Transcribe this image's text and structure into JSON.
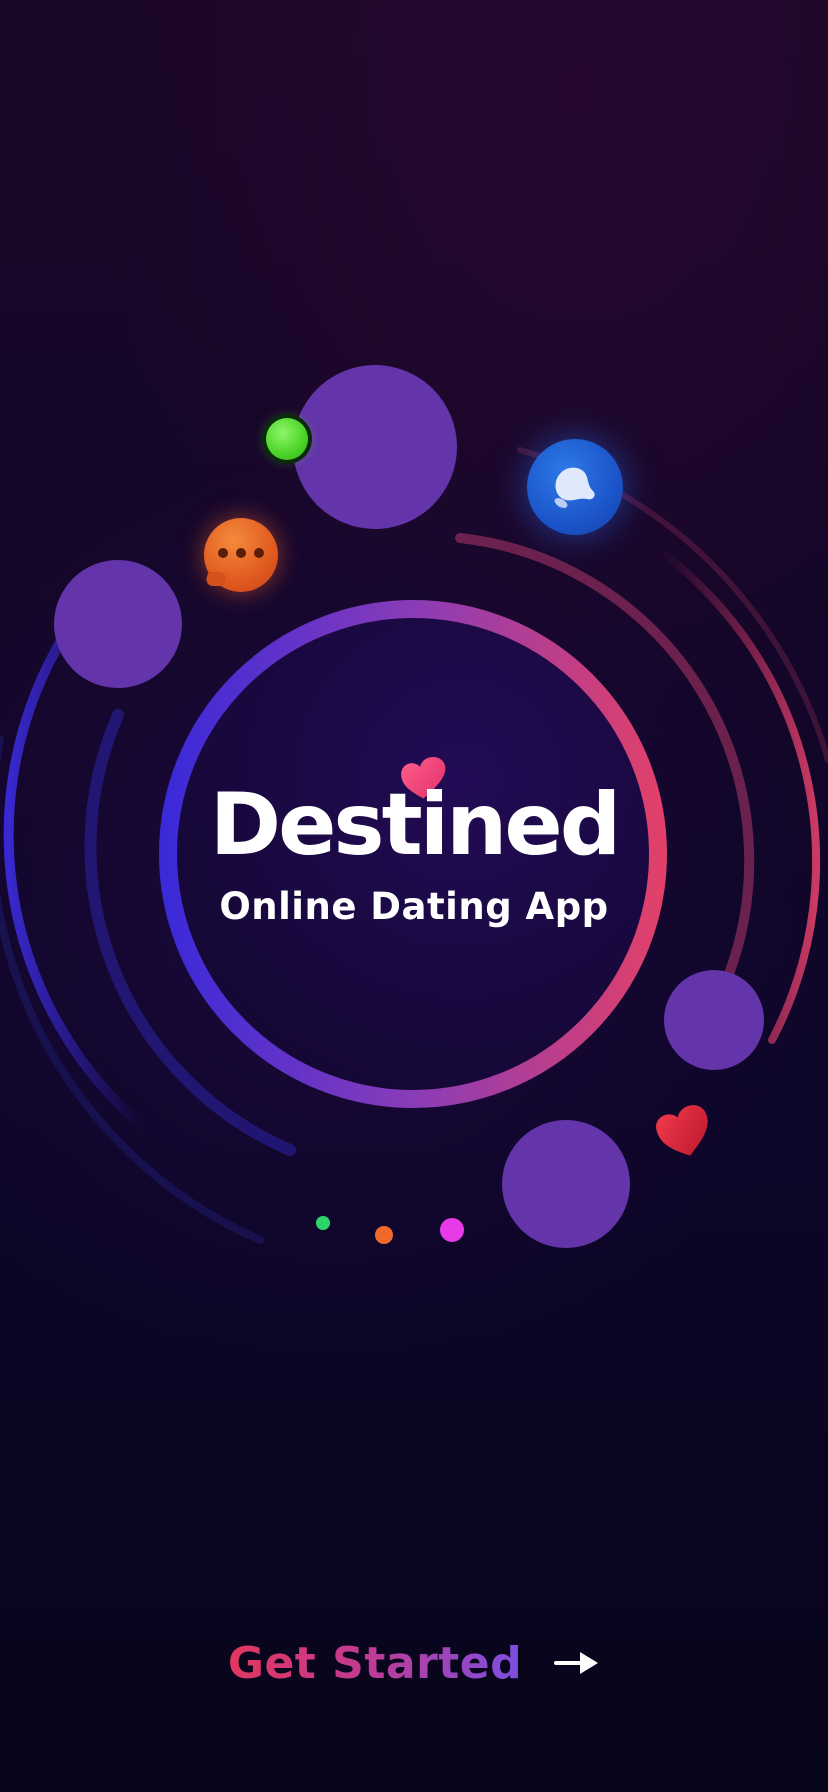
{
  "app": {
    "name": "Destined",
    "tagline": "Online Dating App"
  },
  "cta": {
    "label": "Get Started",
    "arrow_icon": "arrow-right-icon"
  },
  "icons": {
    "chat": "chat-bubble-icon",
    "bell": "notification-bell-icon",
    "heart_small": "heart-icon",
    "heart_red": "heart-icon",
    "online": "online-status-dot"
  },
  "colors": {
    "background_top": "#1a0727",
    "background_bottom": "#07051a",
    "bubble": "#6434aa",
    "ring_start": "#3b2ad8",
    "ring_end": "#e0406a",
    "cta_start": "#e2375f",
    "cta_end": "#7b4fe0",
    "dot_green": "#2bd56a",
    "dot_orange": "#f0692a",
    "dot_magenta": "#e83ae8"
  },
  "page_indicator": {
    "count": 3
  }
}
